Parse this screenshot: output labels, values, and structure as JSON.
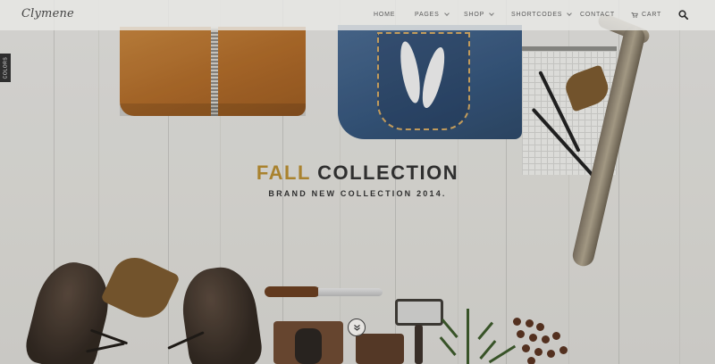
{
  "header": {
    "logo": "Clymene",
    "nav": [
      {
        "label": "HOME",
        "dropdown": false
      },
      {
        "label": "PAGES",
        "dropdown": true
      },
      {
        "label": "SHOP",
        "dropdown": true
      },
      {
        "label": "SHORTCODES",
        "dropdown": true
      },
      {
        "label": "CONTACT",
        "dropdown": false
      }
    ],
    "cart_label": "CART",
    "icons": {
      "cart": "cart-icon",
      "search": "search-icon"
    }
  },
  "side_tab": {
    "label": "COLORS"
  },
  "hero": {
    "title_accent": "FALL",
    "title_rest": "COLLECTION",
    "subtitle": "BRAND NEW COLLECTION 2014.",
    "accent_color": "#a9822e",
    "scroll_icon": "chevron-double-down-icon"
  }
}
